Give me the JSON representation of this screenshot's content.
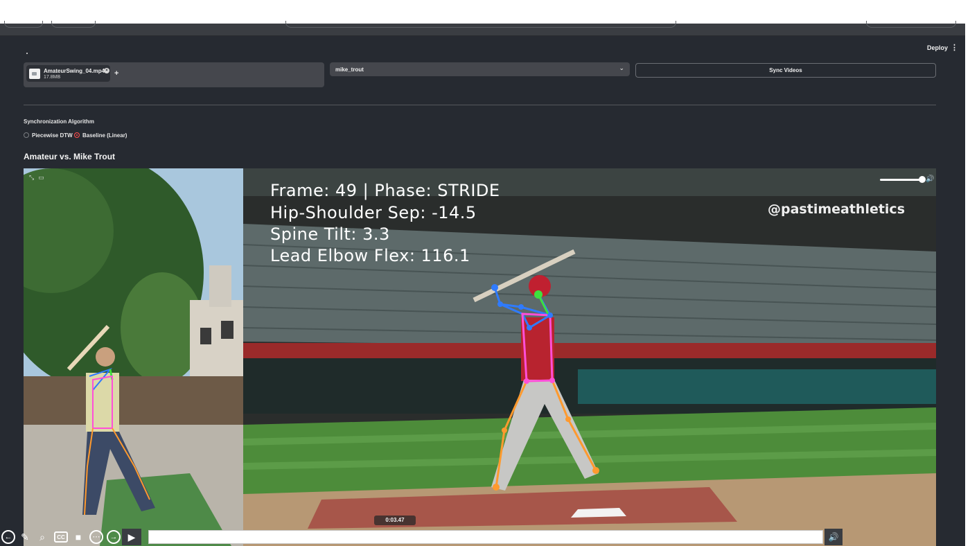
{
  "header": {
    "deploy_label": "Deploy",
    "menu_icon": "kebab-icon"
  },
  "uploader": {
    "file_name": "AmateurSwing_04.mp4",
    "file_size": "17.8MB",
    "add_label": "+"
  },
  "pro_select": {
    "value": "mike_trout"
  },
  "sync_button": {
    "label": "Sync Videos"
  },
  "algorithm": {
    "label": "Synchronization Algorithm",
    "options": [
      {
        "label": "Piecewise DTW",
        "selected": false
      },
      {
        "label": "Baseline (Linear)",
        "selected": true
      }
    ]
  },
  "comparison": {
    "title": "Amateur vs. Mike Trout"
  },
  "video": {
    "overlay": {
      "line1": "Frame: 49 | Phase: STRIDE",
      "line2": "Hip-Shoulder Sep: -14.5",
      "line3": "Spine Tilt: 3.3",
      "line4": "Lead Elbow Flex: 116.1"
    },
    "watermark": "@pastimeathletics",
    "time_tooltip": "0:03.47",
    "volume_level": 0.9
  },
  "player_controls": {
    "icons": [
      "back-icon",
      "pen-icon",
      "search-icon",
      "cc-icon",
      "camera-icon",
      "more-icon",
      "forward-icon"
    ],
    "cc_label": "CC"
  },
  "colors": {
    "background": "#262a31",
    "accent": "#ff4b4b",
    "pose_pink": "#ff4fd8",
    "pose_blue": "#2f7bff",
    "pose_orange": "#ff9a2e",
    "pose_green": "#3ee03e"
  }
}
